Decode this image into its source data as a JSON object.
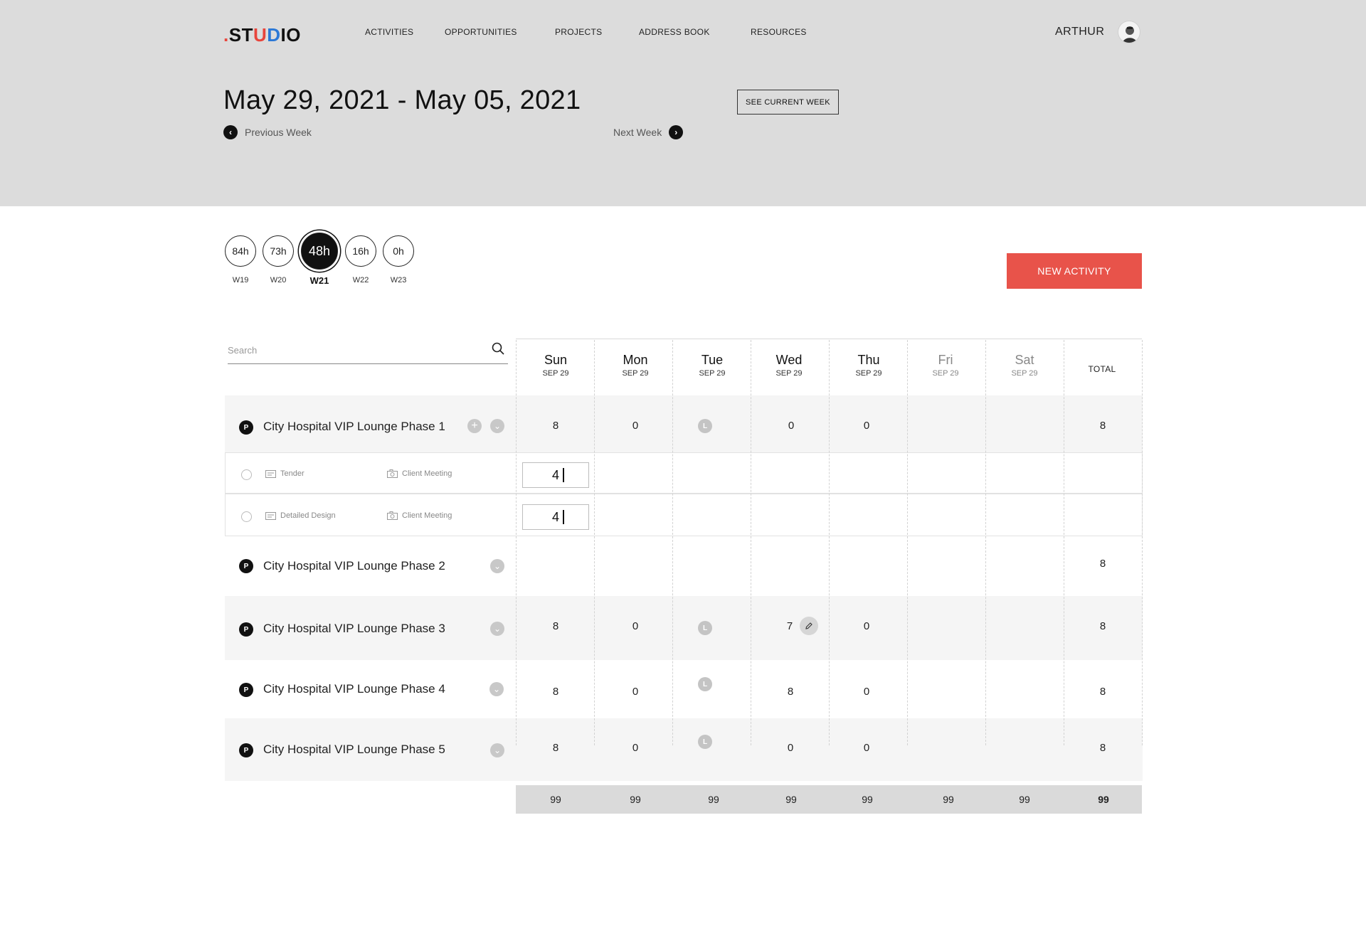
{
  "header": {
    "logo": {
      "dot": ".",
      "s": "ST",
      "u": "U",
      "d": "D",
      "rest": "IO"
    },
    "nav": [
      "ACTIVITIES",
      "OPPORTUNITIES",
      "PROJECTS",
      "ADDRESS BOOK",
      "RESOURCES"
    ],
    "user_name": "ARTHUR",
    "date_range": "May 29, 2021 - May 05, 2021",
    "see_current_week": "SEE CURRENT WEEK",
    "previous_week": "Previous Week",
    "next_week": "Next Week"
  },
  "weeks": [
    {
      "hours": "84h",
      "label": "W19",
      "active": false
    },
    {
      "hours": "73h",
      "label": "W20",
      "active": false
    },
    {
      "hours": "48h",
      "label": "W21",
      "active": true
    },
    {
      "hours": "16h",
      "label": "W22",
      "active": false
    },
    {
      "hours": "0h",
      "label": "W23",
      "active": false
    }
  ],
  "new_activity": "NEW ACTIVITY",
  "search": {
    "placeholder": "Search",
    "value": ""
  },
  "columns": [
    {
      "day": "Sun",
      "date": "SEP 29",
      "weekend": false
    },
    {
      "day": "Mon",
      "date": "SEP 29",
      "weekend": false
    },
    {
      "day": "Tue",
      "date": "SEP 29",
      "weekend": false
    },
    {
      "day": "Wed",
      "date": "SEP 29",
      "weekend": false
    },
    {
      "day": "Thu",
      "date": "SEP 29",
      "weekend": false
    },
    {
      "day": "Fri",
      "date": "SEP 29",
      "weekend": true
    },
    {
      "day": "Sat",
      "date": "SEP 29",
      "weekend": true
    }
  ],
  "total_label": "TOTAL",
  "leave_icon_letter": "L",
  "project_badge_letter": "P",
  "projects": [
    {
      "name": "City Hospital VIP Lounge Phase 1",
      "values": [
        "8",
        "0",
        "L",
        "0",
        "0",
        "",
        ""
      ],
      "total": "8"
    },
    {
      "name": "City Hospital VIP Lounge Phase 2",
      "values": [
        "",
        "",
        "",
        "",
        "",
        "",
        ""
      ],
      "total": "8"
    },
    {
      "name": "City Hospital VIP Lounge Phase 3",
      "values": [
        "8",
        "0",
        "L",
        "7",
        "0",
        "",
        ""
      ],
      "total": "8"
    },
    {
      "name": "City Hospital VIP Lounge Phase 4",
      "values": [
        "8",
        "0",
        "L",
        "8",
        "0",
        "",
        ""
      ],
      "total": "8"
    },
    {
      "name": "City Hospital VIP Lounge Phase 5",
      "values": [
        "8",
        "0",
        "L",
        "0",
        "0",
        "",
        ""
      ],
      "total": "8"
    }
  ],
  "sub_activities": [
    {
      "phase": "Tender",
      "activity": "Client Meeting",
      "hours": "4"
    },
    {
      "phase": "Detailed Design",
      "activity": "Client Meeting",
      "hours": "4"
    }
  ],
  "totals": [
    "99",
    "99",
    "99",
    "99",
    "99",
    "99",
    "99",
    "99"
  ]
}
